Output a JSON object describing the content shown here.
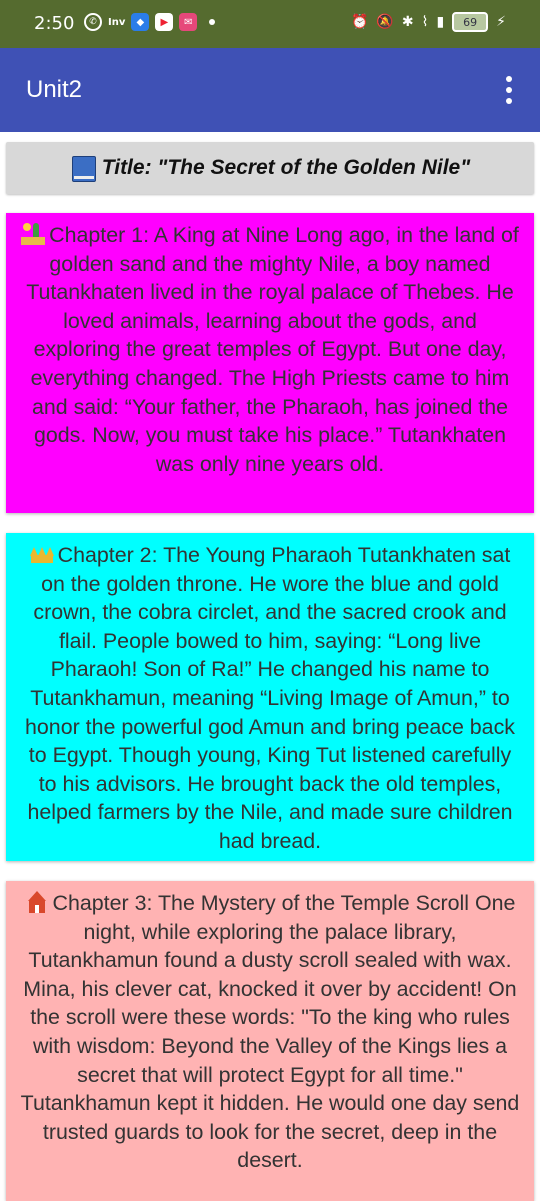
{
  "status": {
    "time": "2:50",
    "battery": "69"
  },
  "app": {
    "title": "Unit2"
  },
  "story_title": "Title: \"The Secret of the Golden Nile\"",
  "chapters": [
    {
      "text": "Chapter 1: A King at Nine Long ago, in the land of golden sand and the mighty Nile, a boy named Tutankhaten lived in the royal palace of Thebes. He loved animals, learning about the gods, and exploring the great temples of Egypt. But one day, everything changed. The High Priests came to him and said: “Your father, the Pharaoh, has joined the gods. Now, you must take his place.” Tutankhaten was only nine years old.",
      "color": "#ff00ff",
      "icon": "desert-icon"
    },
    {
      "text": "Chapter 2: The Young Pharaoh Tutankhaten sat on the golden throne. He wore the blue and gold crown, the cobra circlet, and the sacred crook and flail. People bowed to him, saying: “Long live Pharaoh! Son of Ra!” He changed his name to Tutankhamun, meaning “Living Image of Amun,” to honor the powerful god Amun and bring peace back to Egypt. Though young, King Tut listened carefully to his advisors. He brought back the old temples, helped farmers by the Nile, and made sure children had bread.",
      "color": "#00ffff",
      "icon": "crown-icon"
    },
    {
      "text": "Chapter 3: The Mystery of the Temple Scroll One night, while exploring the palace library, Tutankhamun found a dusty scroll sealed with wax. Mina, his clever cat, knocked it over by accident! On the scroll were these words: \"To the king who rules with wisdom:  Beyond the Valley of the Kings lies a secret  that will protect Egypt for all time.\" Tutankhamun kept it hidden. He would one day send trusted guards to look for the secret, deep in the desert.",
      "color": "#ffb3b3",
      "icon": "temple-icon"
    }
  ]
}
